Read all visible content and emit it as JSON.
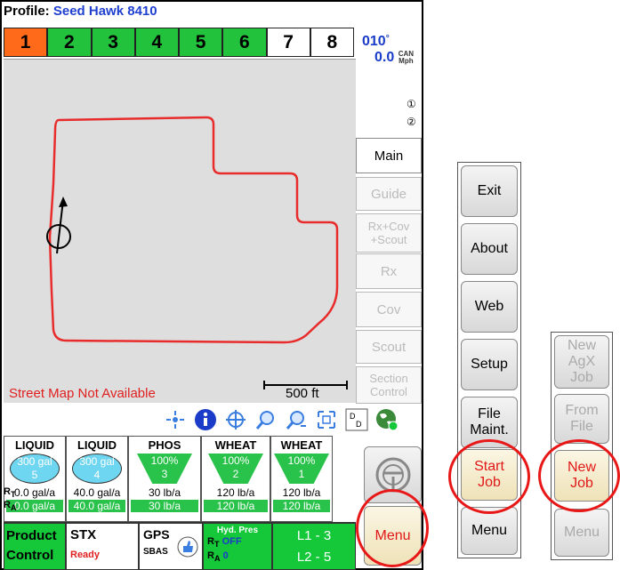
{
  "profile": {
    "label": "Profile:",
    "value": "Seed Hawk 8410"
  },
  "sections": [
    {
      "label": "1",
      "color": "#ff6a1a"
    },
    {
      "label": "2",
      "color": "#22c23c"
    },
    {
      "label": "3",
      "color": "#22c23c"
    },
    {
      "label": "4",
      "color": "#22c23c"
    },
    {
      "label": "5",
      "color": "#22c23c"
    },
    {
      "label": "6",
      "color": "#22c23c"
    },
    {
      "label": "7",
      "color": "#ffffff"
    },
    {
      "label": "8",
      "color": "#ffffff"
    }
  ],
  "heading": {
    "value": "010",
    "unit": "°"
  },
  "speed": {
    "value": "0.0",
    "unit_top": "CAN",
    "unit_bottom": "Mph"
  },
  "side_buttons": [
    "①",
    "②"
  ],
  "tabs": {
    "main": "Main",
    "guide": "Guide",
    "rxcov_line1": "Rx+Cov",
    "rxcov_line2": "+Scout",
    "rx": "Rx",
    "cov": "Cov",
    "scout": "Scout",
    "section_line1": "Section",
    "section_line2": "Control"
  },
  "map": {
    "message": "Street Map Not Available",
    "scale": "500 ft"
  },
  "products": [
    {
      "type": "LIQUID",
      "kind": "tank",
      "fill": "300 gal",
      "num": "5",
      "rate": "0.0 gal/a",
      "actual": "0.0 gal/a"
    },
    {
      "type": "LIQUID",
      "kind": "tank",
      "fill": "300 gal",
      "num": "4",
      "rate": "40.0 gal/a",
      "actual": "40.0 gal/a"
    },
    {
      "type": "PHOS",
      "kind": "hopper",
      "fill": "100%",
      "num": "3",
      "rate": "30 lb/a",
      "actual": "30 lb/a"
    },
    {
      "type": "WHEAT",
      "kind": "hopper",
      "fill": "100%",
      "num": "2",
      "rate": "120 lb/a",
      "actual": "120 lb/a"
    },
    {
      "type": "WHEAT",
      "kind": "hopper",
      "fill": "100%",
      "num": "1",
      "rate": "120 lb/a",
      "actual": "120 lb/a"
    }
  ],
  "rate_labels": {
    "r1": "R",
    "t": "T",
    "r2": "R",
    "a": "A"
  },
  "status": {
    "pc_line1": "Product",
    "pc_line2": "Control",
    "stx": "STX",
    "stx_state": "Ready",
    "gps": "GPS",
    "gps_mode": "SBAS",
    "hyd_title": "Hyd. Pres",
    "hyd_t": "OFF",
    "hyd_a": "0",
    "lane1": "L1 - 3",
    "lane2": "L2 - 5"
  },
  "menu": {
    "main_label": "Menu"
  },
  "panel1": {
    "items": [
      "Exit",
      "About",
      "Web",
      "Setup"
    ],
    "file_line1": "File",
    "file_line2": "Maint.",
    "start_line1": "Start",
    "start_line2": "Job",
    "menu": "Menu"
  },
  "panel2": {
    "new_agx_1": "New",
    "new_agx_2": "AgX",
    "new_agx_3": "Job",
    "from_file_1": "From",
    "from_file_2": "File",
    "new_job_1": "New",
    "new_job_2": "Job",
    "menu": "Menu"
  },
  "colors": {
    "highlight_circle": "#e81818",
    "active_green": "#22c23c",
    "section_off": "#ff6a1a",
    "text_blue": "#1a3cc8"
  }
}
